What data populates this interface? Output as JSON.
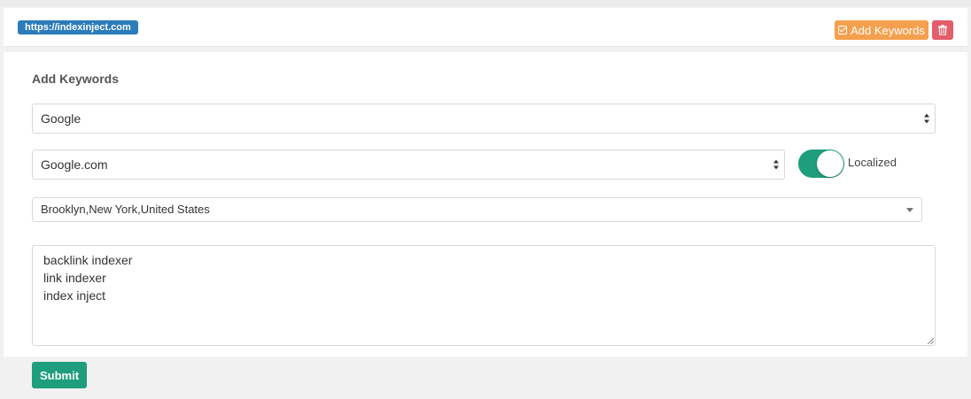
{
  "header": {
    "site_url": "https://indexinject.com",
    "add_keywords_label": "Add Keywords",
    "add_keywords_color": "#f5a04e",
    "delete_color": "#e35d6a",
    "delete_icon": "trash-icon",
    "add_icon": "check-square-icon"
  },
  "form": {
    "title": "Add Keywords",
    "search_engine": {
      "selected": "Google"
    },
    "domain": {
      "selected": "Google.com"
    },
    "localized": {
      "label": "Localized",
      "enabled": true,
      "color": "#1e9e7c"
    },
    "location": {
      "selected": "Brooklyn,New York,United States"
    },
    "keywords": [
      "backlink indexer",
      "link indexer",
      "index inject"
    ],
    "submit_label": "Submit"
  }
}
